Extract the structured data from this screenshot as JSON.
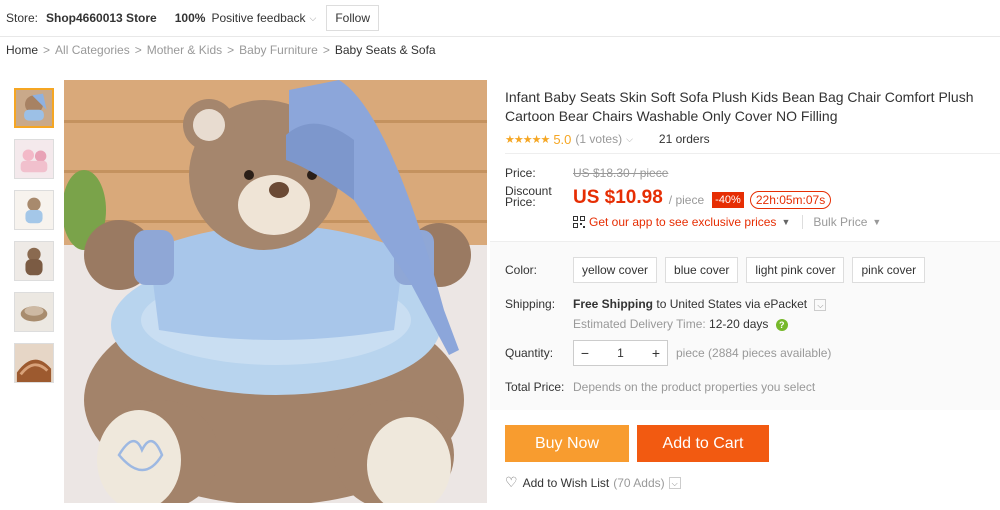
{
  "store": {
    "label": "Store:",
    "name": "Shop4660013 Store",
    "feedback_pct": "100%",
    "feedback_label": "Positive feedback",
    "follow_label": "Follow"
  },
  "breadcrumb": [
    "Home",
    "All Categories",
    "Mother & Kids",
    "Baby Furniture",
    "Baby Seats & Sofa"
  ],
  "product": {
    "title": "Infant Baby Seats Skin Soft Sofa Plush Kids Bean Bag Chair Comfort Plush Cartoon Bear Chairs Washable Only Cover NO Filling",
    "stars": "★★★★★",
    "rating": "5.0",
    "votes": "(1 votes)",
    "orders": "21 orders"
  },
  "price": {
    "label": "Price:",
    "old": "US $18.30 / piece",
    "discount_label": "Discount Price:",
    "new": "US $10.98",
    "per": "/ piece",
    "off": "-40%",
    "timer": "22h:05m:07s",
    "app_link": "Get our app to see exclusive prices",
    "bulk": "Bulk Price"
  },
  "options": {
    "color_label": "Color:",
    "colors": [
      "yellow cover",
      "blue cover",
      "light pink cover",
      "pink cover"
    ]
  },
  "shipping": {
    "label": "Shipping:",
    "free": "Free Shipping",
    "to": "to United States via ePacket",
    "est_label": "Estimated Delivery Time:",
    "est_days": "12-20 days"
  },
  "quantity": {
    "label": "Quantity:",
    "value": "1",
    "available": "piece (2884 pieces available)"
  },
  "total": {
    "label": "Total Price:",
    "note": "Depends on the product properties you select"
  },
  "actions": {
    "buy_now": "Buy Now",
    "add_to_cart": "Add to Cart",
    "wish_label": "Add to Wish List",
    "wish_count": "(70 Adds)"
  },
  "colors": {
    "price_red": "#e62e04",
    "star_orange": "#f5a623",
    "buy_orange": "#f89c2f",
    "cart_orange": "#f25a11"
  }
}
